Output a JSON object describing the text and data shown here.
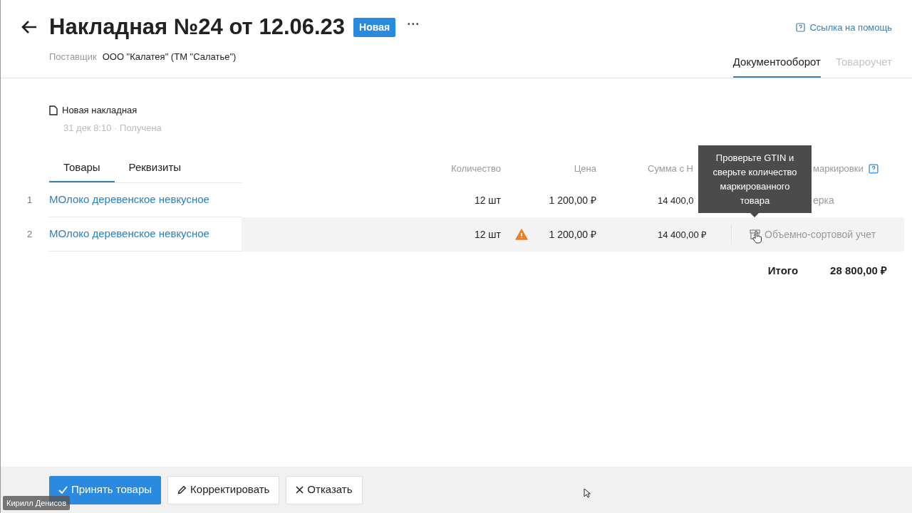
{
  "header": {
    "title": "Накладная №24 от 12.06.23",
    "status_badge": "Новая",
    "more": "···",
    "supplier_label": "Поставщик",
    "supplier": "ООО \"Калатея\" (ТМ \"Салатье\")",
    "help_link": "Ссылка на помощь"
  },
  "view_tabs": [
    {
      "label": "Документооборот",
      "selected": true
    },
    {
      "label": "Товароучет",
      "selected": false
    }
  ],
  "document": {
    "name": "Новая накладная",
    "meta": "31 дек 8:10 · Получена"
  },
  "tabs": [
    {
      "label": "Товары",
      "selected": true
    },
    {
      "label": "Реквизиты",
      "selected": false
    }
  ],
  "table": {
    "columns": [
      "Количество",
      "Цена",
      "Сумма с Н",
      "маркировки"
    ],
    "rows": [
      {
        "index": "1",
        "name": "МОлоко деревенское невкусное",
        "quantity": "12 шт",
        "warning": false,
        "price": "1 200,00 ₽",
        "sum": "14 400,0",
        "marking": "ерка",
        "marking_icon": false,
        "selected": false
      },
      {
        "index": "2",
        "name": "МОлоко деревенское невкусное",
        "quantity": "12 шт",
        "warning": true,
        "price": "1 200,00 ₽",
        "sum": "14 400,00 ₽",
        "marking": "Объемно-сортовой учет",
        "marking_icon": true,
        "selected": true
      }
    ],
    "total_label": "Итого",
    "total": "28 800,00 ₽"
  },
  "tooltip": "Проверьте GTIN и сверьте количество маркированного товара",
  "buttons": [
    {
      "kind": "primary",
      "label": "Принять товары"
    },
    {
      "kind": "edit",
      "label": "Корректировать"
    },
    {
      "kind": "cancel",
      "label": "Отказать"
    }
  ],
  "participant_name": "Кирилл Денисов"
}
